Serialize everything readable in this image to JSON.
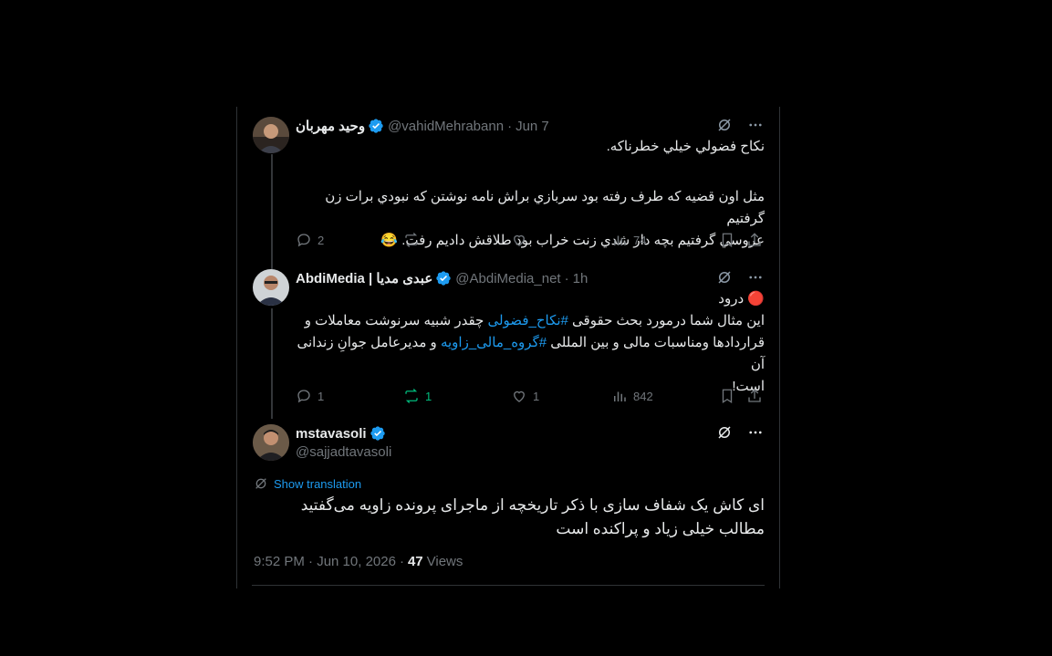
{
  "replies": [
    {
      "name": "وحید مهربان",
      "handle": "@vahidMehrabann",
      "time": "Jun 7",
      "lines": [
        "نكاح فضولي خيلي خطرناكه.",
        "",
        "مثل اون قضيه كه طرف رفته بود سربازي براش نامه نوشتن كه نبودي برات زن گرفتيم",
        "عروسي گرفتيم بچه دار شدي زنت خراب بود طلاقش داديم رفت. 😂"
      ],
      "stats": {
        "replies": "2",
        "reposts": "",
        "likes": "",
        "views": "74"
      }
    },
    {
      "name": "AbdiMedia | عبدی مدیا",
      "handle": "@AbdiMedia_net",
      "time": "1h",
      "greeting": "🔴 درود",
      "line1_pre": "این مثال شما درمورد بحث حقوقی ",
      "hashtag1": "#نکاح_فضولی",
      "line1_post": " چقدر شبیه سرنوشت معاملات و",
      "line2_pre": "قراردادها ومناسبات مالی و بین المللی ",
      "hashtag2": "#گروه_مالی_زاویه",
      "line2_post": " و مدیرعامل جوانِ زندانی آن",
      "line3": "است!",
      "stats": {
        "replies": "1",
        "reposts": "1",
        "likes": "1",
        "views": "842"
      }
    }
  ],
  "main": {
    "name": "mstavasoli",
    "handle": "@sajjadtavasoli",
    "translate_label": "Show translation",
    "lines": [
      "ای کاش یک شفاف سازی با ذکر تاریخچه از ماجرای پرونده زاویه می‌گفتید",
      "مطالب خیلی زیاد و پراکنده است"
    ],
    "timestamp": "9:52 PM · Jun 10, 2026",
    "views_count": "47",
    "views_label": "Views"
  },
  "colors": {
    "accent": "#1d9bf0",
    "repost_active": "#00ba7c",
    "muted": "#71767b",
    "verified": "#1d9bf0"
  },
  "icons": [
    "grok-icon",
    "more-icon",
    "reply-icon",
    "repost-icon",
    "like-icon",
    "views-icon",
    "bookmark-icon",
    "share-icon",
    "verified-badge-icon",
    "translate-icon"
  ]
}
